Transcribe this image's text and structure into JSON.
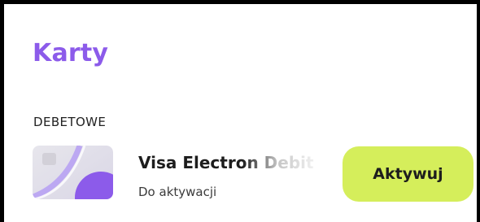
{
  "header": {
    "title": "Karty"
  },
  "section": {
    "label": "DEBETOWE"
  },
  "card": {
    "name": "Visa Electron Debit",
    "status": "Do aktywacji",
    "action_label": "Aktywuj"
  },
  "colors": {
    "title": "#8C5BEA",
    "button": "#D5EE5B",
    "card_accent": "#8C5BEA"
  },
  "icons": {
    "card_image": "debit-card-icon"
  }
}
